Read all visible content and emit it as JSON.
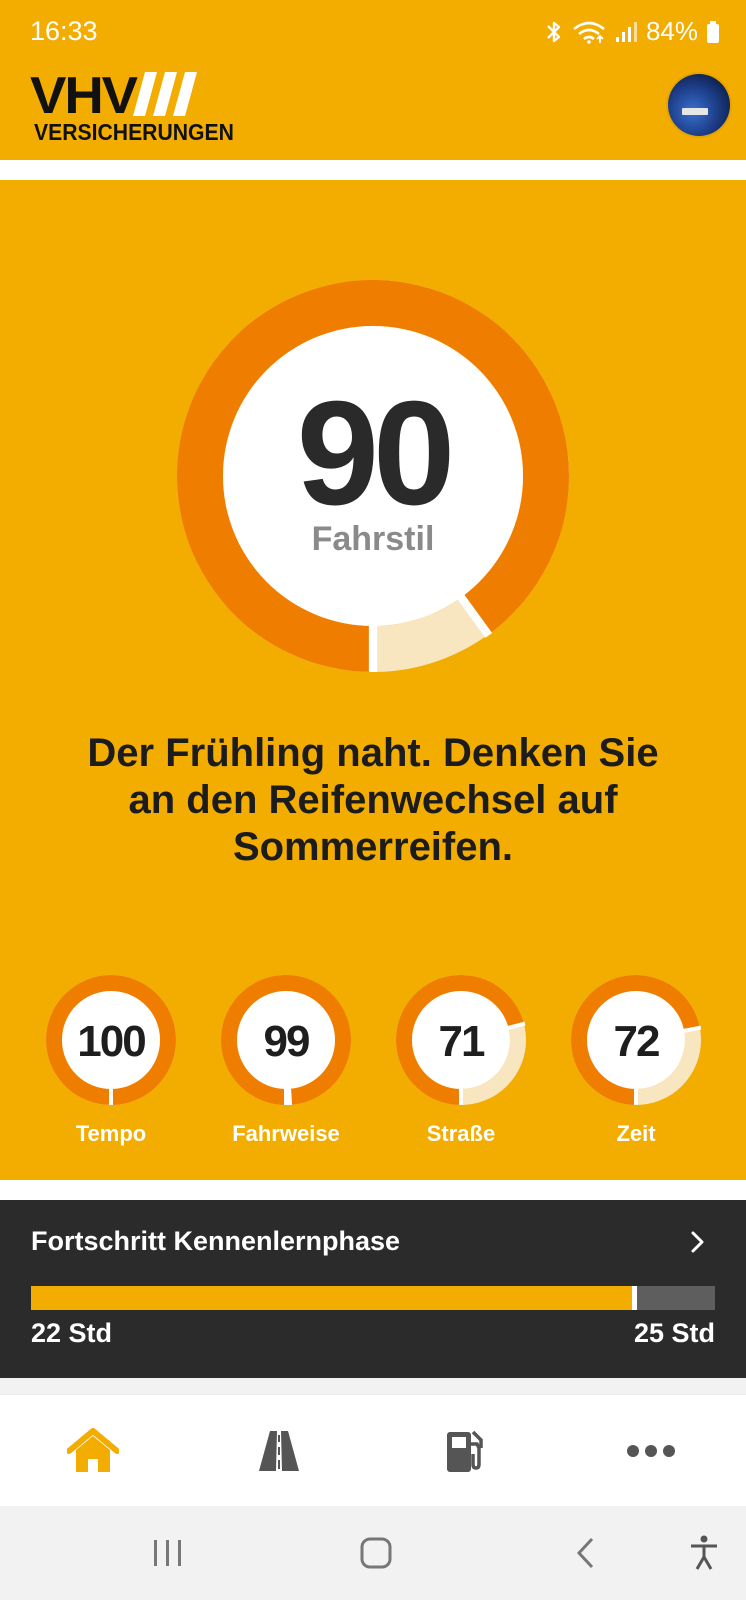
{
  "status": {
    "time": "16:33",
    "battery": "84%",
    "icons": [
      "bluetooth-icon",
      "wifi-icon",
      "signal-icon",
      "battery-icon"
    ]
  },
  "header": {
    "logo_line1": "VHV",
    "logo_line2": "VERSICHERUNGEN",
    "avatar": "car-avatar"
  },
  "main_score": {
    "value": "90",
    "label": "Fahrstil",
    "fraction": 0.9
  },
  "message": "Der Frühling naht. Denken Sie an den Reifenwechsel auf Sommerreifen.",
  "sub_scores": [
    {
      "value": "100",
      "label": "Tempo",
      "fraction": 1.0
    },
    {
      "value": "99",
      "label": "Fahrweise",
      "fraction": 0.99
    },
    {
      "value": "71",
      "label": "Straße",
      "fraction": 0.71
    },
    {
      "value": "72",
      "label": "Zeit",
      "fraction": 0.72
    }
  ],
  "progress": {
    "title": "Fortschritt Kennenlernphase",
    "start_label": "22 Std",
    "end_label": "25 Std",
    "fraction": 0.88
  },
  "bottom_nav": [
    {
      "name": "home-icon",
      "active": true
    },
    {
      "name": "road-icon",
      "active": false
    },
    {
      "name": "fuel-icon",
      "active": false
    },
    {
      "name": "more-icon",
      "active": false
    }
  ],
  "colors": {
    "brand_yellow": "#f3ac00",
    "ring_orange": "#ef7d00",
    "ring_light": "#f8e6c0",
    "dark": "#2b2b2b"
  }
}
